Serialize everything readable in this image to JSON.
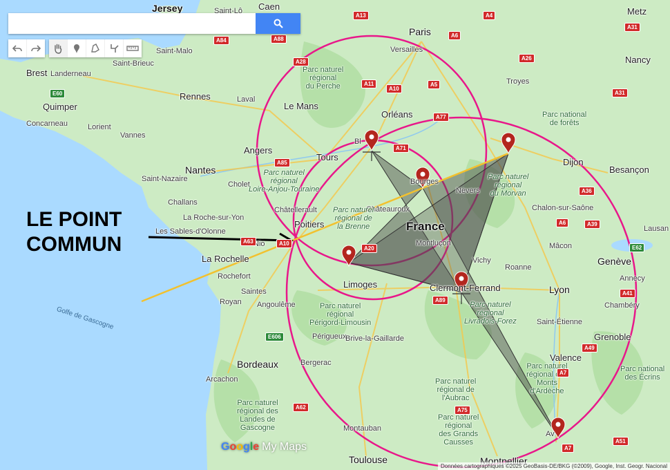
{
  "search": {
    "placeholder": ""
  },
  "toolbar": {
    "tools": [
      "undo-icon",
      "redo-icon",
      "hand-icon",
      "marker-icon",
      "polygon-icon",
      "route-icon",
      "ruler-icon"
    ]
  },
  "annotation": {
    "line1": "LE POINT",
    "line2": "COMMUN"
  },
  "places": {
    "jersey": "Jersey",
    "saint_lo": "Saint-Lô",
    "caen": "Caen",
    "metz": "Metz",
    "paris": "Paris",
    "versailles": "Versailles",
    "saint_malo": "Saint-Malo",
    "saint_brieuc": "Saint-Brieuc",
    "brest": "Brest",
    "landerneau": "Landerneau",
    "rennes": "Rennes",
    "laval": "Laval",
    "le_mans": "Le Mans",
    "quimper": "Quimper",
    "concarneau": "Concarneau",
    "lorient": "Lorient",
    "vannes": "Vannes",
    "orleans": "Orléans",
    "troyes": "Troyes",
    "nancy": "Nancy",
    "angers": "Angers",
    "tours": "Tours",
    "blois": "Bl",
    "nantes": "Nantes",
    "saint_nazaire": "Saint-Nazaire",
    "cholet": "Cholet",
    "bourges": "Bourges",
    "dijon": "Dijon",
    "besancon": "Besançon",
    "nevers": "Nevers",
    "challans": "Challans",
    "la_roche_sur_yon": "La Roche-sur-Yon",
    "chatellerault": "Châtellerault",
    "poitiers": "Poitiers",
    "chateauroux": "Châteauroux",
    "chalon": "Chalon-sur-Saône",
    "les_sables": "Les Sables-d'Olonne",
    "niort": "Nio",
    "la_rochelle": "La Rochelle",
    "france": "France",
    "montlucon": "Montluçon",
    "vichy": "Vichy",
    "macon": "Mâcon",
    "geneve": "Genève",
    "lausanne": "Lausan",
    "rochefort": "Rochefort",
    "limoges": "Limoges",
    "roanne": "Roanne",
    "annecy": "Annecy",
    "saintes": "Saintes",
    "royan": "Royan",
    "angouleme": "Angoulême",
    "clermont": "Clermont-Ferrand",
    "lyon": "Lyon",
    "chambery": "Chambéry",
    "saint_etienne": "Saint-Étienne",
    "perigueux": "Périgueux",
    "brive": "Brive-la-Gaillarde",
    "grenoble": "Grenoble",
    "bordeaux": "Bordeaux",
    "bergerac": "Bergerac",
    "valence": "Valence",
    "arcachon": "Arcachon",
    "montauban": "Montauban",
    "toulouse": "Toulouse",
    "montpellier": "Montpellier",
    "avignon": "Av",
    "golfe": "Golfe de Gascogne"
  },
  "parks": {
    "perche": [
      "Parc naturel",
      "régional",
      "du Perche"
    ],
    "foret": [
      "Parc national",
      "de forêts"
    ],
    "loire": [
      "Parc naturel",
      "régional",
      "Loire-Anjou-Touraine"
    ],
    "morvan": [
      "Parc naturel",
      "régional",
      "du Morvan"
    ],
    "brenne": [
      "Parc naturel",
      "régional de",
      "la Brenne"
    ],
    "livradois": [
      "Parc naturel",
      "régional",
      "Livradois-Forez"
    ],
    "perigord": [
      "Parc naturel",
      "régional",
      "Périgord-Limousin"
    ],
    "ardeche": [
      "Parc naturel",
      "régional des",
      "Monts",
      "d'Ardèche"
    ],
    "ecrins": [
      "Parc national",
      "des Écrins"
    ],
    "aubrac": [
      "Parc naturel",
      "régional de",
      "l'Aubrac"
    ],
    "landes": [
      "Parc naturel",
      "régional des",
      "Landes de",
      "Gascogne"
    ],
    "causses": [
      "Parc naturel",
      "régional",
      "des Grands",
      "Causses"
    ]
  },
  "roads": [
    "A13",
    "A4",
    "A31",
    "A84",
    "A88",
    "A28",
    "A6",
    "A26",
    "E60",
    "A11",
    "A10",
    "A5",
    "A71",
    "A31",
    "A85",
    "A77",
    "A36",
    "A39",
    "A20",
    "A6",
    "E62",
    "A89",
    "A41",
    "A63",
    "E606",
    "A49",
    "A7",
    "A62",
    "A75",
    "A51",
    "A7",
    "A10"
  ],
  "logo": {
    "g": "G",
    "o1": "o",
    "o2": "o",
    "g2": "g",
    "l": "l",
    "e": "e",
    "my_maps": "My Maps"
  },
  "attribution": "Données cartographiques ©2025 GeoBasis-DE/BKG (©2009), Google, Inst. Geogr. Nacional",
  "colors": {
    "circle": "#e8178a",
    "line": "#f2c12e",
    "polygon": "#595959",
    "marker": "#b3261e"
  }
}
